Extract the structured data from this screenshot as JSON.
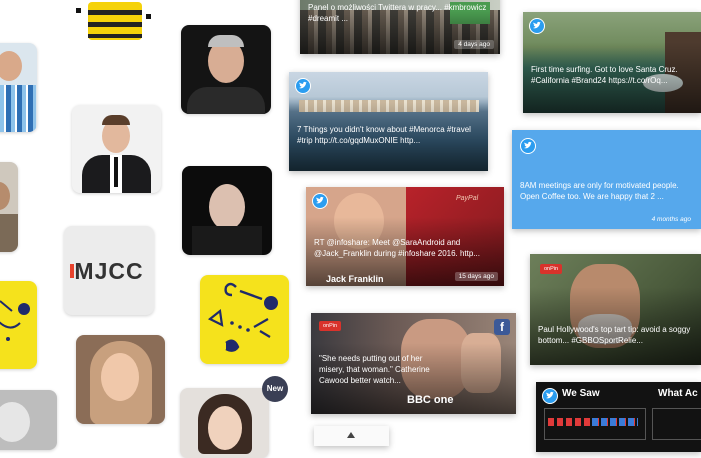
{
  "tiles": {
    "mjcc_logo_text": "MJCC",
    "new_badge": "New"
  },
  "cards": [
    {
      "id": "card-top",
      "text": "Panel o możliwości Twittera w pracy... #kmbrowicz #dreamit ...",
      "time": "4 days ago"
    },
    {
      "id": "card-surf",
      "text": "First time surfing. Got to love Santa Cruz. #California #Brand24 https://t.co/rOq..."
    },
    {
      "id": "card-menorca",
      "text": "7 Things you didn't know about #Menorca #travel #trip http://t.co/gqdMuxONIE http..."
    },
    {
      "id": "card-coffee",
      "text": "8AM meetings are only for motivated people. Open Coffee too. We are happy that 2 ...",
      "time": "4 months ago"
    },
    {
      "id": "card-infoshare",
      "text": "RT @infoshare: Meet @SaraAndroid and @Jack_Franklin during #infoshare 2016. http...",
      "time": "15 days ago",
      "brand": "PayPal",
      "name_overlay": "Jack Franklin"
    },
    {
      "id": "card-hollywood",
      "text": "Paul Hollywood's top tart tip: avoid a soggy bottom... #GBBOSportRelie...",
      "badge": "onPin"
    },
    {
      "id": "card-bbc",
      "text": "\"She needs putting out of her misery, that woman.\" Catherine Cawood better watch...",
      "badge": "onPin",
      "channel": "BBC one"
    },
    {
      "id": "card-infographic",
      "left_label": "We Saw",
      "right_label": "What Ac"
    }
  ],
  "colors": {
    "twitter": "#2b9df0",
    "facebook": "#3b5998",
    "tile_yellow": "#f5e21c",
    "coffee_card": "#56a8ec",
    "red_badge": "#d9322b"
  }
}
